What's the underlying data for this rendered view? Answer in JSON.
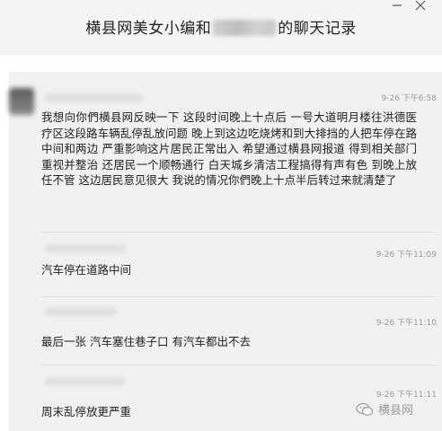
{
  "window": {
    "title_prefix": "横县网美女小编和",
    "title_suffix": "的聊天记录",
    "min_icon": "minimize-icon",
    "close_icon": "close-icon"
  },
  "messages": [
    {
      "time": "9-26 下午6:58",
      "text": "我想向你們横县网反映一下 这段时间晚上十点后 一号大道明月楼往洪德医疗区这段路车辆乱停乱放问题 晚上到这边吃烧烤和到大排挡的人把车停在路中间和两边 严重影响这片居民正常出入 希望通过横县网报道 得到相关部门重视并整治 还居民一个顺畅通行 白天城乡清洁工程搞得有声有色 到晚上放任不管 这边居民意见很大 我说的情况你們晚上十点半后转过来就清楚了"
    },
    {
      "time": "9-26 下午11:09",
      "text": "汽车停在道路中间"
    },
    {
      "time": "9-26 下午11:10",
      "text": "最后一张 汽车塞住巷子口 有汽车都出不去"
    },
    {
      "time": "9-26 下午11:11",
      "text": "周末乱停放更严重"
    }
  ],
  "watermark": {
    "text": "横县网",
    "icon": "wechat-icon"
  }
}
